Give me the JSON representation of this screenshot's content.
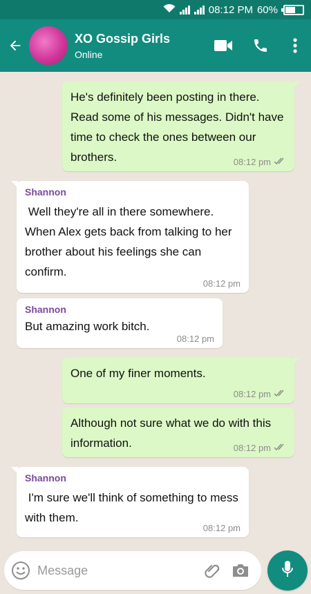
{
  "status_bar": {
    "time": "08:12 PM",
    "battery": "60%"
  },
  "header": {
    "title": "XO Gossip Girls",
    "status": "Online",
    "icons": [
      "back-arrow-icon",
      "video-call-icon",
      "phone-icon",
      "more-vert-icon"
    ]
  },
  "messages": [
    {
      "direction": "out",
      "text": "He's definitely been posting in there. Read some of his messages. Didn't have time to check the ones between our brothers.",
      "time": "08:12 pm",
      "ticks": "double"
    },
    {
      "direction": "in",
      "sender": "Shannon",
      "text": " Well they're all in there somewhere. When Alex gets back from talking to her brother about his feelings she can confirm.",
      "time": "08:12 pm"
    },
    {
      "direction": "in",
      "sender": "Shannon",
      "text": "But amazing work bitch.",
      "time": "08:12 pm"
    },
    {
      "direction": "out",
      "text": "One of my finer moments.",
      "time": "08:12 pm",
      "ticks": "double"
    },
    {
      "direction": "out",
      "text": "Although not sure what we do with this information.",
      "time": "08:12 pm",
      "ticks": "double"
    },
    {
      "direction": "in",
      "sender": "Shannon",
      "text": " I'm sure we'll think of something to mess with them.",
      "time": "08:12 pm"
    }
  ],
  "input": {
    "placeholder": "Message"
  },
  "colors": {
    "header": "#128c7e",
    "status_bar": "#0f7a6c",
    "outgoing": "#dcf8c6",
    "incoming": "#ffffff",
    "sender": "#7b4a9e"
  }
}
